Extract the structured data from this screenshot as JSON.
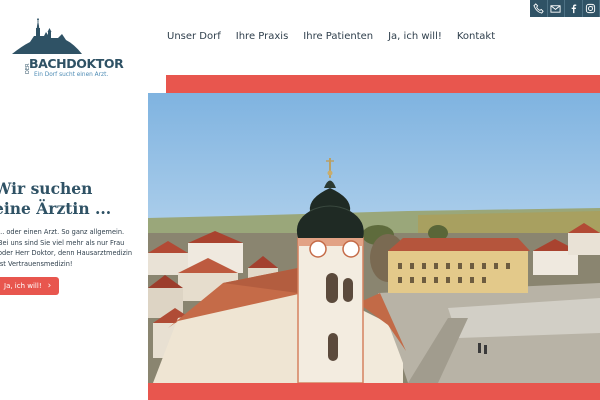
{
  "brand": {
    "name": "BACHDOKTOR",
    "vertical_text": "DER",
    "tagline": "Ein Dorf sucht einen Arzt."
  },
  "nav": {
    "items": [
      {
        "label": "Unser Dorf"
      },
      {
        "label": "Ihre Praxis"
      },
      {
        "label": "Ihre Patienten"
      },
      {
        "label": "Ja, ich will!"
      },
      {
        "label": "Kontakt"
      }
    ]
  },
  "social": {
    "icons": [
      "phone-icon",
      "mail-icon",
      "facebook-icon",
      "instagram-icon"
    ]
  },
  "hero": {
    "headline_line1": "Wir suchen",
    "headline_line2": "eine Ärztin ...",
    "body": "... oder einen Arzt. So ganz allgemein. Bei uns sind Sie viel mehr als nur Frau oder Herr Doktor, denn Hausarztmedizin ist Vertrauensmedizin!",
    "cta_label": "Ja, ich will!",
    "image_alt": "Village church with onion dome"
  },
  "colors": {
    "primary": "#2f5265",
    "accent": "#e8564e",
    "text": "#2f3f4c",
    "tagline": "#4d8bb4"
  }
}
